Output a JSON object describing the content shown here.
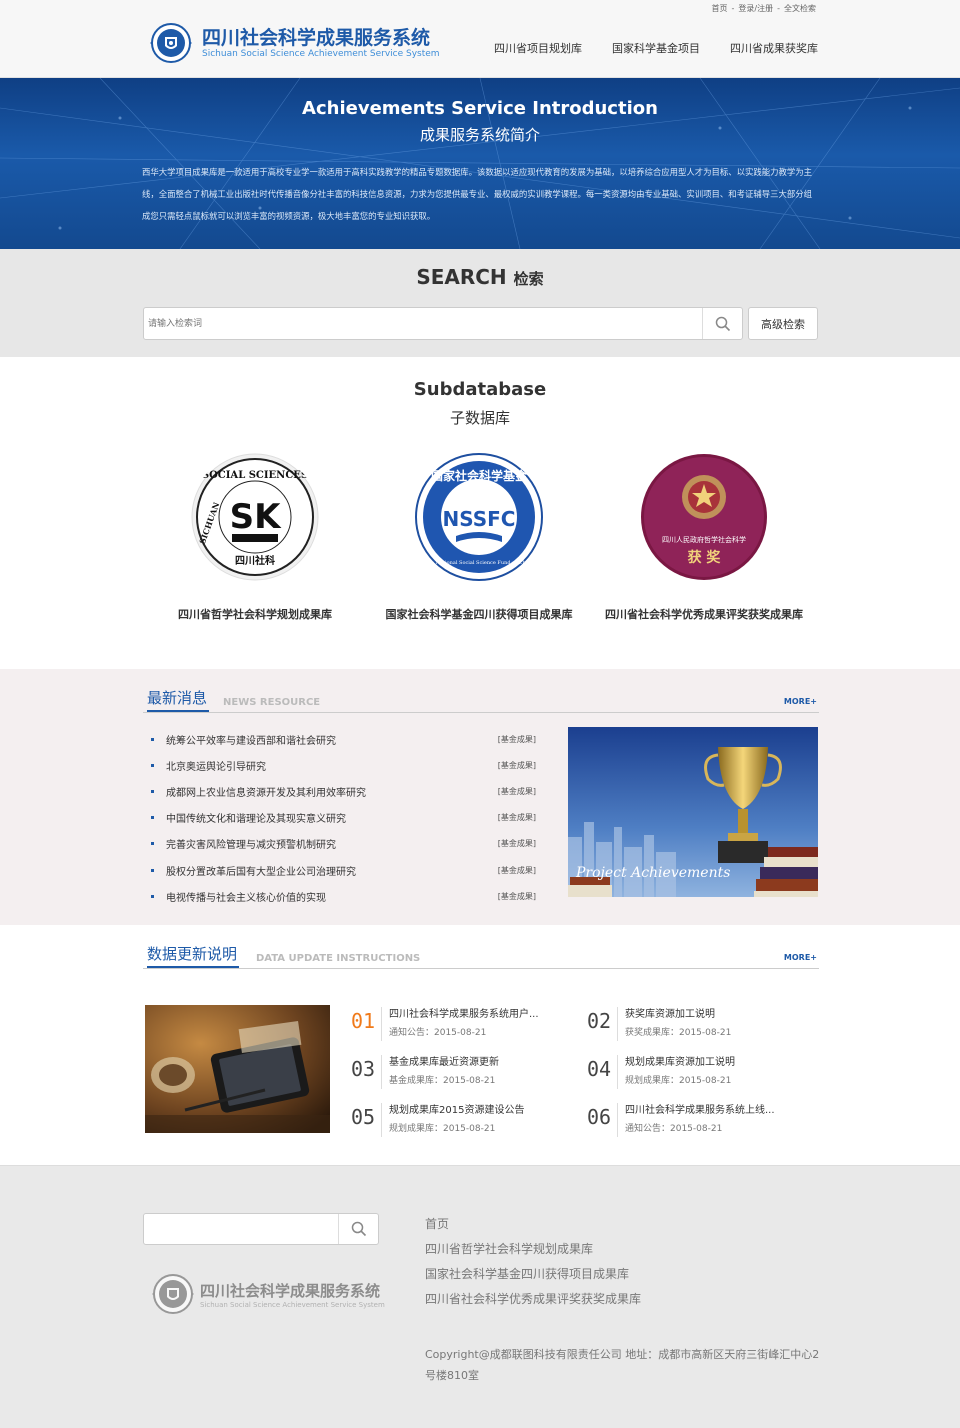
{
  "header": {
    "top_links": [
      "首页",
      "登录/注册",
      "全文检索"
    ],
    "top_sep": "-",
    "logo_title": "四川社会科学成果服务系统",
    "logo_subtitle": "Sichuan Social Science Achievement Service System",
    "nav": [
      "四川省项目规划库",
      "国家科学基金项目",
      "四川省成果获奖库"
    ]
  },
  "banner": {
    "title": "Achievements Service Introduction",
    "subtitle": "成果服务系统简介",
    "description": "西华大学项目成果库是一款适用于高校专业学一款适用于高科实践教学的精品专题数据库。该数据以适应现代教育的发展为基础，以培养综合应用型人才为目标、以实践能力教学为主线，全面整合了机械工业出版社时代传播音像分社丰富的科技信息资源，力求为您提供最专业、最权威的实训教学课程。每一类资源均由专业基础、实训项目、和考证辅导三大部分组成您只需轻点鼠标就可以浏览丰富的视频资源，极大地丰富您的专业知识获取。"
  },
  "search": {
    "heading_en": "SEARCH",
    "heading_cn": "检索",
    "placeholder": "请输入检索词",
    "advanced_label": "高级检索"
  },
  "subdatabase": {
    "title": "Subdatabase",
    "subtitle": "子数据库",
    "items": [
      {
        "label": "四川省哲学社会科学规划成果库",
        "badge_text_top": "SOCIAL SCIENCES",
        "badge_text_left": "SICHUAN",
        "badge_mark": "SK",
        "badge_text_bottom": "四川社科"
      },
      {
        "label": "国家社会科学基金四川获得项目成果库",
        "badge_text_top": "国家社会科学基金",
        "badge_mark": "NSSFC",
        "badge_text_bottom": "The National Social Science Fund of China"
      },
      {
        "label": "四川省社会科学优秀成果评奖获奖成果库",
        "badge_text_line1": "四川人民政府哲学社会科学",
        "badge_text_line2": "获 奖"
      }
    ]
  },
  "news": {
    "title_cn": "最新消息",
    "title_en": "NEWS RESOURCE",
    "more": "MORE+",
    "items": [
      {
        "title": "统筹公平效率与建设西部和谐社会研究",
        "tag": "[基金成果]"
      },
      {
        "title": "北京奥运舆论引导研究",
        "tag": "[基金成果]"
      },
      {
        "title": "成都网上农业信息资源开发及其利用效率研究",
        "tag": "[基金成果]"
      },
      {
        "title": "中国传统文化和谐理论及其现实意义研究",
        "tag": "[基金成果]"
      },
      {
        "title": "完善灾害风险管理与减灾预警机制研究",
        "tag": "[基金成果]"
      },
      {
        "title": "股权分置改革后国有大型企业公司治理研究",
        "tag": "[基金成果]"
      },
      {
        "title": "电视传播与社会主义核心价值的实现",
        "tag": "[基金成果]"
      }
    ],
    "image_caption": "Project Achievements"
  },
  "updates": {
    "title_cn": "数据更新说明",
    "title_en": "DATA UPDATE INSTRUCTIONS",
    "more": "MORE+",
    "items": [
      {
        "num": "01",
        "title": "四川社会科学成果服务系统用户...",
        "meta": "通知公告：2015-08-21"
      },
      {
        "num": "02",
        "title": "获奖库资源加工说明",
        "meta": "获奖成果库：2015-08-21"
      },
      {
        "num": "03",
        "title": "基金成果库最近资源更新",
        "meta": "基金成果库：2015-08-21"
      },
      {
        "num": "04",
        "title": "规划成果库资源加工说明",
        "meta": "规划成果库：2015-08-21"
      },
      {
        "num": "05",
        "title": "规划成果库2015资源建设公告",
        "meta": "规划成果库：2015-08-21"
      },
      {
        "num": "06",
        "title": "四川社会科学成果服务系统上线...",
        "meta": "通知公告：2015-08-21"
      }
    ]
  },
  "footer": {
    "search_placeholder": "",
    "logo_title": "四川社会科学成果服务系统",
    "logo_subtitle": "Sichuan Social Science Achievement Service System",
    "links": [
      "首页",
      "四川省哲学社会科学规划成果库",
      "国家社会科学基金四川获得项目成果库",
      "四川省社会科学优秀成果评奖获奖成果库"
    ],
    "copyright": "Copyright@成都联图科技有限责任公司 地址：成都市高新区天府三街峰汇中心2号楼810室"
  },
  "colors": {
    "brand_blue": "#1e5aa8",
    "accent_orange": "#f07a1a",
    "banner_blue": "#13498f"
  }
}
